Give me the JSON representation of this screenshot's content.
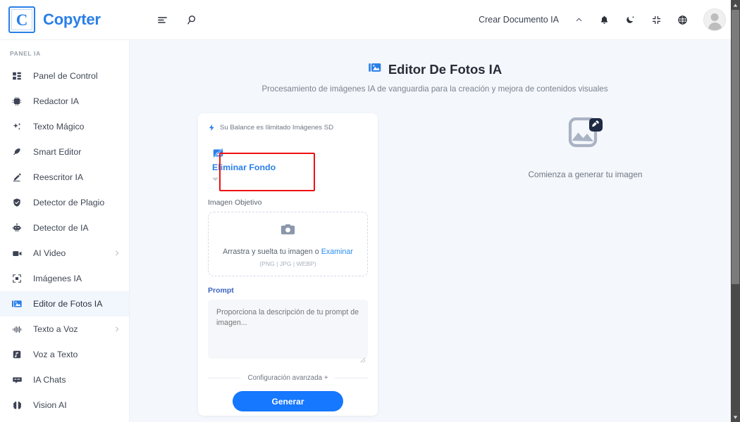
{
  "brand": {
    "logo_letter": "C",
    "name": "Copyter"
  },
  "topbar": {
    "menu_icon": "align-left-icon",
    "search_icon": "search-icon",
    "create_document_label": "Crear Documento IA",
    "chevron_up_icon": "chevron-up-icon",
    "bell_icon": "bell-icon",
    "moon_icon": "moon-icon",
    "fullscreen_icon": "compress-icon",
    "globe_icon": "globe-icon",
    "avatar": "user-avatar"
  },
  "sidebar": {
    "section_label": "PANEL IA",
    "items": [
      {
        "label": "Panel de Control",
        "icon": "dashboard-icon",
        "active": false,
        "chevron": false
      },
      {
        "label": "Redactor IA",
        "icon": "chip-ai-icon",
        "active": false,
        "chevron": false
      },
      {
        "label": "Texto Mágico",
        "icon": "sparkles-icon",
        "active": false,
        "chevron": false
      },
      {
        "label": "Smart Editor",
        "icon": "feather-icon",
        "active": false,
        "chevron": false
      },
      {
        "label": "Reescritor IA",
        "icon": "pencil-icon",
        "active": false,
        "chevron": false
      },
      {
        "label": "Detector de Plagio",
        "icon": "shield-check-icon",
        "active": false,
        "chevron": false
      },
      {
        "label": "Detector de IA",
        "icon": "robot-icon",
        "active": false,
        "chevron": false
      },
      {
        "label": "AI Video",
        "icon": "video-camera-icon",
        "active": false,
        "chevron": true
      },
      {
        "label": "Imágenes IA",
        "icon": "image-frame-icon",
        "active": false,
        "chevron": false
      },
      {
        "label": "Editor de Fotos IA",
        "icon": "photo-edit-icon",
        "active": true,
        "chevron": false
      },
      {
        "label": "Texto a Voz",
        "icon": "waveform-icon",
        "active": false,
        "chevron": true
      },
      {
        "label": "Voz a Texto",
        "icon": "music-note-icon",
        "active": false,
        "chevron": false
      },
      {
        "label": "IA Chats",
        "icon": "chat-icon",
        "active": false,
        "chevron": false
      },
      {
        "label": "Vision AI",
        "icon": "brain-icon",
        "active": false,
        "chevron": false
      }
    ]
  },
  "page": {
    "title": "Editor De Fotos IA",
    "title_icon": "photo-edit-icon",
    "subtitle": "Procesamiento de imágenes IA de vanguardia para la creación y mejora de contenidos visuales"
  },
  "form": {
    "balance_text": "Su Balance es Ilimitado Imágenes SD",
    "balance_icon": "bolt-icon",
    "mode": {
      "label": "Eliminar Fondo",
      "icon": "image-slash-icon",
      "caret_icon": "caret-down-icon",
      "highlighted": true,
      "highlight_color": "#ee1111"
    },
    "image_field_label": "Imagen Objetivo",
    "dropzone": {
      "icon": "camera-icon",
      "text": "Arrastra y suelta tu imagen o",
      "link": "Examinar",
      "formats": "(PNG | JPG | WEBP)"
    },
    "prompt_label": "Prompt",
    "prompt_value": "",
    "prompt_placeholder": "Proporciona la descripción de tu prompt de imagen...",
    "advanced_label": "Configuración avanzada +",
    "generate_label": "Generar"
  },
  "preview": {
    "placeholder_icon": "image-edit-placeholder-icon",
    "text": "Comienza a generar tu imagen"
  },
  "colors": {
    "accent": "#2a7fe8",
    "button": "#1677ff",
    "page_bg": "#f4f7fb",
    "highlight": "#ee1111"
  }
}
